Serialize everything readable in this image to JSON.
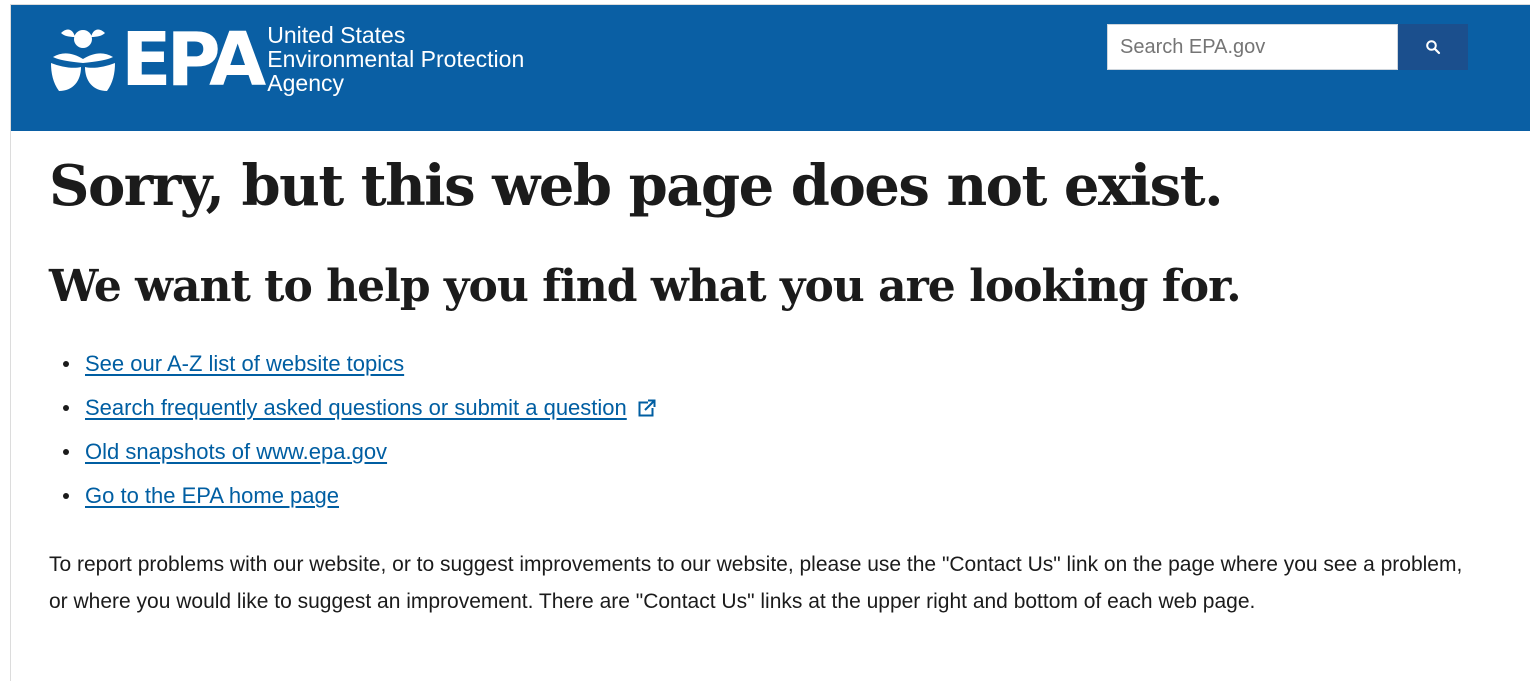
{
  "header": {
    "logo": {
      "abbr": "EPA",
      "line1": "United States",
      "line2": "Environmental Protection",
      "line3": "Agency",
      "icon": "epa-flower-logo"
    },
    "search": {
      "placeholder": "Search EPA.gov",
      "button_icon": "search-icon"
    }
  },
  "main": {
    "title": "Sorry, but this web page does not exist.",
    "subtitle": "We want to help you find what you are looking for.",
    "links": [
      {
        "label": "See our A-Z list of website topics",
        "external": false
      },
      {
        "label": "Search frequently asked questions or submit a question",
        "external": true,
        "icon": "external-link-icon"
      },
      {
        "label": "Old snapshots of www.epa.gov",
        "external": false
      },
      {
        "label": "Go to the EPA home page",
        "external": false
      }
    ],
    "report_text": "To report problems with our website, or to suggest improvements to our website, please use the \"Contact Us\" link on the page where you see a problem, or where you would like to suggest an improvement. There are \"Contact Us\" links at the upper right and bottom of each web page."
  },
  "colors": {
    "header_bg": "#0a5fa4",
    "search_button": "#1b4f8d",
    "link": "#005ea2"
  }
}
